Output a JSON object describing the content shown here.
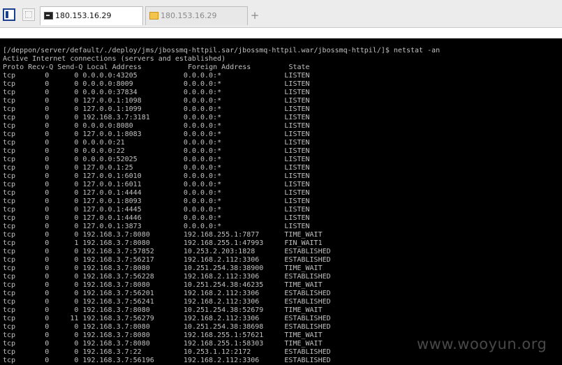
{
  "tabs": [
    {
      "label": "180.153.16.29",
      "icon": "terminal-icon",
      "active": true
    },
    {
      "label": "180.153.16.29",
      "icon": "folder-icon",
      "active": false
    }
  ],
  "new_tab_label": "+",
  "terminal": {
    "prompt": "[/deppon/server/default/./deploy/jms/jbossmq-httpil.sar/jbossmq-httpil.war/jbossmq-httpil/]$ netstat -an",
    "banner": "Active Internet connections (servers and established)",
    "header": {
      "proto": "Proto",
      "recvq": "Recv-Q",
      "sendq": "Send-Q",
      "local": "Local Address",
      "foreign": "Foreign Address",
      "state": "State"
    },
    "rows": [
      {
        "proto": "tcp",
        "recvq": "0",
        "sendq": "0",
        "local": "0.0.0.0:43205",
        "foreign": "0.0.0.0:*",
        "state": "LISTEN"
      },
      {
        "proto": "tcp",
        "recvq": "0",
        "sendq": "0",
        "local": "0.0.0.0:8009",
        "foreign": "0.0.0.0:*",
        "state": "LISTEN"
      },
      {
        "proto": "tcp",
        "recvq": "0",
        "sendq": "0",
        "local": "0.0.0.0:37834",
        "foreign": "0.0.0.0:*",
        "state": "LISTEN"
      },
      {
        "proto": "tcp",
        "recvq": "0",
        "sendq": "0",
        "local": "127.0.0.1:1098",
        "foreign": "0.0.0.0:*",
        "state": "LISTEN"
      },
      {
        "proto": "tcp",
        "recvq": "0",
        "sendq": "0",
        "local": "127.0.0.1:1099",
        "foreign": "0.0.0.0:*",
        "state": "LISTEN"
      },
      {
        "proto": "tcp",
        "recvq": "0",
        "sendq": "0",
        "local": "192.168.3.7:3181",
        "foreign": "0.0.0.0:*",
        "state": "LISTEN"
      },
      {
        "proto": "tcp",
        "recvq": "0",
        "sendq": "0",
        "local": "0.0.0.0:8080",
        "foreign": "0.0.0.0:*",
        "state": "LISTEN"
      },
      {
        "proto": "tcp",
        "recvq": "0",
        "sendq": "0",
        "local": "127.0.0.1:8083",
        "foreign": "0.0.0.0:*",
        "state": "LISTEN"
      },
      {
        "proto": "tcp",
        "recvq": "0",
        "sendq": "0",
        "local": "0.0.0.0:21",
        "foreign": "0.0.0.0:*",
        "state": "LISTEN"
      },
      {
        "proto": "tcp",
        "recvq": "0",
        "sendq": "0",
        "local": "0.0.0.0:22",
        "foreign": "0.0.0.0:*",
        "state": "LISTEN"
      },
      {
        "proto": "tcp",
        "recvq": "0",
        "sendq": "0",
        "local": "0.0.0.0:52025",
        "foreign": "0.0.0.0:*",
        "state": "LISTEN"
      },
      {
        "proto": "tcp",
        "recvq": "0",
        "sendq": "0",
        "local": "127.0.0.1:25",
        "foreign": "0.0.0.0:*",
        "state": "LISTEN"
      },
      {
        "proto": "tcp",
        "recvq": "0",
        "sendq": "0",
        "local": "127.0.0.1:6010",
        "foreign": "0.0.0.0:*",
        "state": "LISTEN"
      },
      {
        "proto": "tcp",
        "recvq": "0",
        "sendq": "0",
        "local": "127.0.0.1:6011",
        "foreign": "0.0.0.0:*",
        "state": "LISTEN"
      },
      {
        "proto": "tcp",
        "recvq": "0",
        "sendq": "0",
        "local": "127.0.0.1:4444",
        "foreign": "0.0.0.0:*",
        "state": "LISTEN"
      },
      {
        "proto": "tcp",
        "recvq": "0",
        "sendq": "0",
        "local": "127.0.0.1:8093",
        "foreign": "0.0.0.0:*",
        "state": "LISTEN"
      },
      {
        "proto": "tcp",
        "recvq": "0",
        "sendq": "0",
        "local": "127.0.0.1:4445",
        "foreign": "0.0.0.0:*",
        "state": "LISTEN"
      },
      {
        "proto": "tcp",
        "recvq": "0",
        "sendq": "0",
        "local": "127.0.0.1:4446",
        "foreign": "0.0.0.0:*",
        "state": "LISTEN"
      },
      {
        "proto": "tcp",
        "recvq": "0",
        "sendq": "0",
        "local": "127.0.0.1:3873",
        "foreign": "0.0.0.0:*",
        "state": "LISTEN"
      },
      {
        "proto": "tcp",
        "recvq": "0",
        "sendq": "0",
        "local": "192.168.3.7:8080",
        "foreign": "192.168.255.1:7877",
        "state": "TIME_WAIT"
      },
      {
        "proto": "tcp",
        "recvq": "0",
        "sendq": "1",
        "local": "192.168.3.7:8080",
        "foreign": "192.168.255.1:47993",
        "state": "FIN_WAIT1"
      },
      {
        "proto": "tcp",
        "recvq": "0",
        "sendq": "0",
        "local": "192.168.3.7:57852",
        "foreign": "10.253.2.203:1828",
        "state": "ESTABLISHED"
      },
      {
        "proto": "tcp",
        "recvq": "0",
        "sendq": "0",
        "local": "192.168.3.7:56217",
        "foreign": "192.168.2.112:3306",
        "state": "ESTABLISHED"
      },
      {
        "proto": "tcp",
        "recvq": "0",
        "sendq": "0",
        "local": "192.168.3.7:8080",
        "foreign": "10.251.254.38:38900",
        "state": "TIME_WAIT"
      },
      {
        "proto": "tcp",
        "recvq": "0",
        "sendq": "0",
        "local": "192.168.3.7:56228",
        "foreign": "192.168.2.112:3306",
        "state": "ESTABLISHED"
      },
      {
        "proto": "tcp",
        "recvq": "0",
        "sendq": "0",
        "local": "192.168.3.7:8080",
        "foreign": "10.251.254.38:46235",
        "state": "TIME_WAIT"
      },
      {
        "proto": "tcp",
        "recvq": "0",
        "sendq": "0",
        "local": "192.168.3.7:56201",
        "foreign": "192.168.2.112:3306",
        "state": "ESTABLISHED"
      },
      {
        "proto": "tcp",
        "recvq": "0",
        "sendq": "0",
        "local": "192.168.3.7:56241",
        "foreign": "192.168.2.112:3306",
        "state": "ESTABLISHED"
      },
      {
        "proto": "tcp",
        "recvq": "0",
        "sendq": "0",
        "local": "192.168.3.7:8080",
        "foreign": "10.251.254.38:52679",
        "state": "TIME_WAIT"
      },
      {
        "proto": "tcp",
        "recvq": "0",
        "sendq": "11",
        "local": "192.168.3.7:56279",
        "foreign": "192.168.2.112:3306",
        "state": "ESTABLISHED"
      },
      {
        "proto": "tcp",
        "recvq": "0",
        "sendq": "0",
        "local": "192.168.3.7:8080",
        "foreign": "10.251.254.38:38698",
        "state": "ESTABLISHED"
      },
      {
        "proto": "tcp",
        "recvq": "0",
        "sendq": "0",
        "local": "192.168.3.7:8080",
        "foreign": "192.168.255.1:57621",
        "state": "TIME_WAIT"
      },
      {
        "proto": "tcp",
        "recvq": "0",
        "sendq": "0",
        "local": "192.168.3.7:8080",
        "foreign": "192.168.255.1:58303",
        "state": "TIME_WAIT"
      },
      {
        "proto": "tcp",
        "recvq": "0",
        "sendq": "0",
        "local": "192.168.3.7:22",
        "foreign": "10.253.1.12:2172",
        "state": "ESTABLISHED"
      },
      {
        "proto": "tcp",
        "recvq": "0",
        "sendq": "0",
        "local": "192.168.3.7:56196",
        "foreign": "192.168.2.112:3306",
        "state": "ESTABLISHED"
      }
    ]
  },
  "watermark": "www.wooyun.org"
}
